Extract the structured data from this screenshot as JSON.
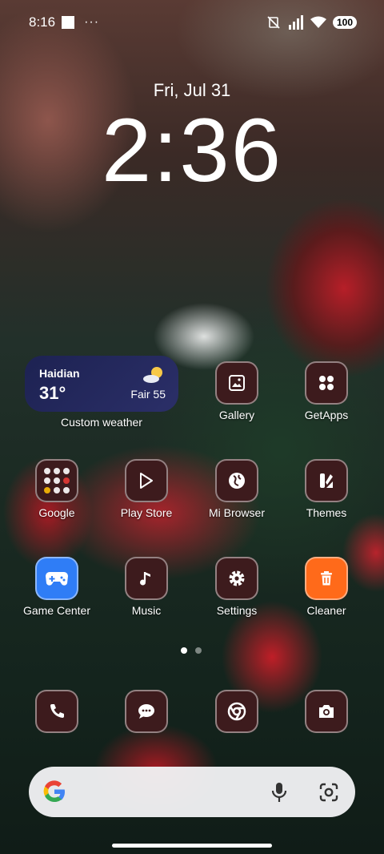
{
  "status_bar": {
    "time": "8:16",
    "more": "···",
    "battery": "100"
  },
  "lockscreen": {
    "date": "Fri, Jul 31",
    "clock": "2:36"
  },
  "weather_widget": {
    "city": "Haidian",
    "temperature": "31°",
    "condition": "Fair 55",
    "label": "Custom weather"
  },
  "apps": {
    "gallery": "Gallery",
    "getapps": "GetApps",
    "google": "Google",
    "playstore": "Play Store",
    "mibrowser": "Mi Browser",
    "themes": "Themes",
    "gamecenter": "Game Center",
    "music": "Music",
    "settings": "Settings",
    "cleaner": "Cleaner"
  },
  "dock": [
    "phone-icon",
    "messages-icon",
    "chrome-icon",
    "camera-icon"
  ],
  "colors": {
    "icon_bg": "#3d1b1d",
    "widget_bg": "#1d2252",
    "cleaner_orange": "#ff6a1a"
  }
}
